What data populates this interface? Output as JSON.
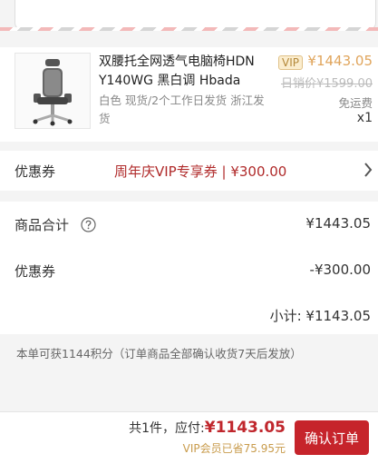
{
  "product": {
    "title": "双腰托全网透气电脑椅HDN Y140WG 黑白调 Hbada",
    "sku": "白色  现货/2个工作日发货  浙江发货",
    "vip_badge": "VIP",
    "price": "¥1443.05",
    "original_price": "日销价¥1599.00",
    "shipping": "免运费",
    "quantity": "x1",
    "thumbnail_icon": "office-chair-icon"
  },
  "coupon": {
    "label": "优惠券",
    "value": "周年庆VIP专享券 | ¥300.00"
  },
  "totals": {
    "goods_label": "商品合计",
    "goods_value": "¥1443.05",
    "discount_label": "优惠券",
    "discount_value": "-¥300.00",
    "subtotal_label": "小计:",
    "subtotal_value": "¥1143.05"
  },
  "points_note": "本单可获1144积分（订单商品全部确认收货7天后发放）",
  "bottom": {
    "count_text": "共1件，应付:",
    "pay_amount": "¥1143.05",
    "saved_text": "VIP会员已省75.95元",
    "confirm_label": "确认订单"
  },
  "colors": {
    "accent": "#c6242b",
    "vip_gold": "#e0a55c",
    "coupon_red": "#b02a2a"
  }
}
